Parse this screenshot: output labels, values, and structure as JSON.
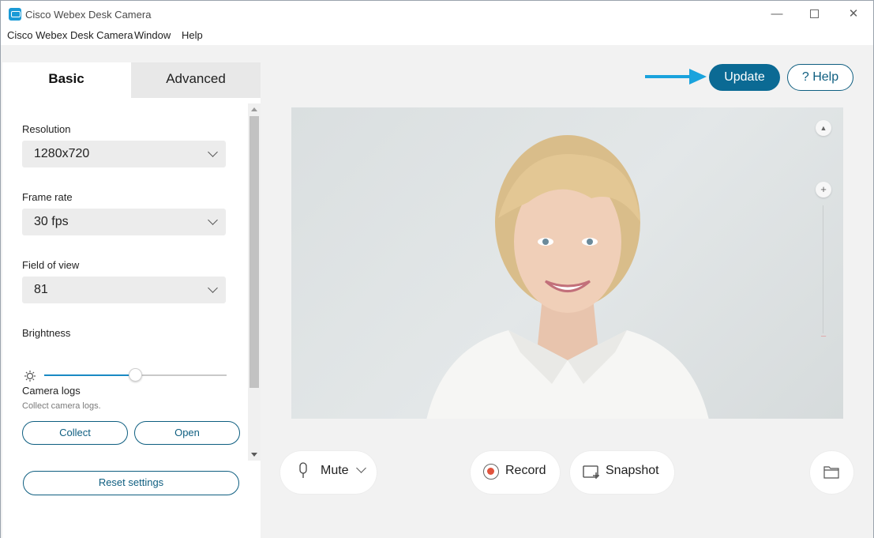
{
  "window": {
    "title": "Cisco Webex Desk Camera",
    "controls": {
      "minimize": "—",
      "close": "✕"
    }
  },
  "menu": [
    "Cisco Webex Desk Camera",
    "Window",
    "Help"
  ],
  "tabs": {
    "basic": "Basic",
    "advanced": "Advanced"
  },
  "settings": {
    "resolution": {
      "label": "Resolution",
      "value": "1280x720"
    },
    "frame_rate": {
      "label": "Frame rate",
      "value": "30 fps"
    },
    "field_of_view": {
      "label": "Field of view",
      "value": "81"
    },
    "brightness": {
      "label": "Brightness",
      "level": 0.5
    },
    "camera_logs": {
      "label": "Camera logs",
      "description": "Collect camera logs.",
      "collect": "Collect",
      "open": "Open"
    },
    "reset": "Reset settings"
  },
  "header_buttons": {
    "update": "Update",
    "help": "? Help"
  },
  "preview_controls": {
    "up": "▲",
    "zoom_in": "+",
    "zoom_out": "−"
  },
  "bottom_controls": {
    "mute": "Mute",
    "record": "Record",
    "snapshot": "Snapshot"
  },
  "colors": {
    "accent": "#0b6a94",
    "arrow": "#1aa3dd",
    "record_dot": "#e0533d"
  }
}
